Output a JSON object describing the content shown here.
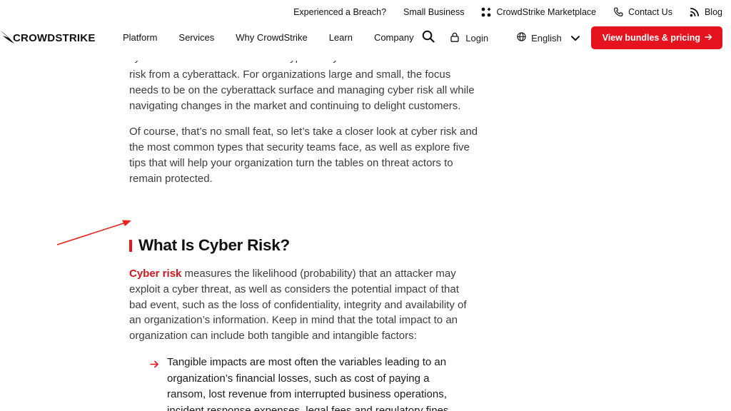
{
  "utility": {
    "breach": "Experienced a Breach?",
    "small_business": "Small Business",
    "marketplace": "CrowdStrike Marketplace",
    "contact": "Contact Us",
    "blog": "Blog"
  },
  "logo": {
    "text": "CROWDSTRIKE"
  },
  "nav": {
    "platform": "Platform",
    "services": "Services",
    "why": "Why CrowdStrike",
    "learn": "Learn",
    "company": "Company",
    "login": "Login",
    "language": "English",
    "cta": "View bundles & pricing"
  },
  "article": {
    "cut_line": "cyber risk and the most common types of cyber risk to reduce",
    "para1": "risk from a cyberattack. For organizations large and small, the focus needs to be on the cyberattack surface and managing cyber risk all while navigating changes in the market and continuing to delight customers.",
    "para2": "Of course, that’s no small feat, so let’s take a closer look at cyber risk and the most common types that security teams face, as well as explore five tips that will help your organization turn the tables on threat actors to remain protected.",
    "heading": "What Is Cyber Risk?",
    "link": "Cyber risk",
    "para3": " measures the likelihood (probability) that an attacker may exploit a cyber threat, as well as considers the potential impact of that bad event, such as the loss of confidentiality, integrity and availability of an organization’s information. Keep in mind that the total impact to an organization can include both tangible and intangible factors:",
    "bullet1": "Tangible impacts are most often the variables leading to an organization’s financial losses, such as cost of paying a ransom, lost revenue from interrupted business operations, incident response expenses, legal fees and regulatory fines."
  },
  "colors": {
    "brand_red": "#e5131d",
    "link_red": "#d4151c",
    "annotation_red": "#e8231c"
  }
}
